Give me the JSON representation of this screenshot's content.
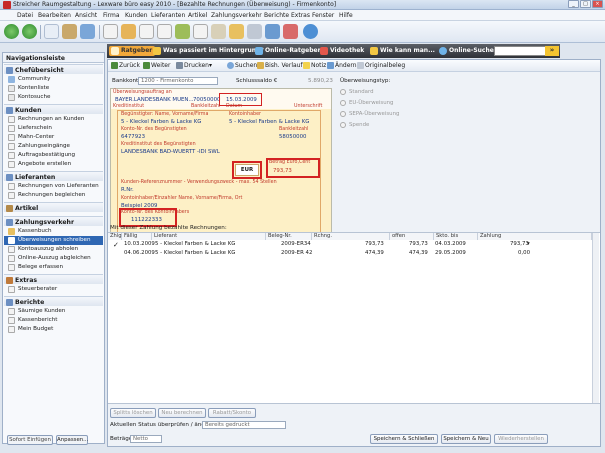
{
  "window": {
    "title": "Streicher Raumgestaltung - Lexware büro easy 2010 - [Bezahlte Rechnungen (Überweisung) - Firmenkonto]"
  },
  "menu": [
    "Datei",
    "Bearbeiten",
    "Ansicht",
    "Firma",
    "Kunden",
    "Lieferanten",
    "Artikel",
    "Zahlungsverkehr",
    "Berichte",
    "Extras",
    "Fenster",
    "Hilfe"
  ],
  "ratgeber": {
    "tabs": [
      "Ratgeber",
      "Was passiert im Hintergrund?",
      "Online-Ratgeber",
      "Videothek",
      "Wie kann man...",
      "Online-Suche"
    ],
    "search_value": "",
    "go": "»"
  },
  "nav": {
    "title": "Navigationsleiste",
    "sections": [
      {
        "label": "Chefübersicht",
        "items": [
          "Community",
          "Kontenliste",
          "Kontosuche"
        ]
      },
      {
        "label": "Kunden",
        "items": [
          "Rechnungen an Kunden",
          "Lieferschein",
          "Mahn-Center",
          "Zahlungseingänge",
          "Auftragsbestätigung",
          "Angebote erstellen"
        ]
      },
      {
        "label": "Lieferanten",
        "items": [
          "Rechnungen von Lieferanten",
          "Rechnungen begleichen"
        ]
      },
      {
        "label": "Artikel",
        "items": []
      },
      {
        "label": "Zahlungsverkehr",
        "items": [
          "Kassenbuch",
          "Überweisungen schreiben",
          "Kontoauszug abholen",
          "Online-Auszug abgleichen",
          "Belege erfassen"
        ]
      },
      {
        "label": "Extras",
        "items": [
          "Steuerberater"
        ]
      },
      {
        "label": "Berichte",
        "items": [
          "Säumige Kunden",
          "Kassenbericht",
          "Mein Budget"
        ]
      }
    ],
    "selected": "Überweisungen schreiben",
    "buttons": [
      "Sofort Einfügen",
      "Anpassen..."
    ]
  },
  "subtoolbar": [
    "Zurück",
    "Weiter",
    "Drucken",
    "Suchen",
    "Bish. Verlauf",
    "Notiz",
    "Ändern",
    "Originalbeleg"
  ],
  "form": {
    "bankkonto_label": "Bankkonto",
    "bankkonto_value": "1200 - Firmenkonto",
    "schlusssaldo_label": "Schlusssaldo €",
    "schlusssaldo_value": "5.890,23",
    "ueberweisungstyp_label": "Überweisungstyp:",
    "types": [
      "Standard",
      "EU-Überweisung",
      "SEPA-Überweisung",
      "Spende"
    ],
    "auftrag": "Überweisungsauftrag an",
    "bank_name": "BAYER.LANDESBANK MUEN...",
    "blz": "70050000",
    "date": "15.03.2009",
    "kreditinstitut_lbl": "Kreditinstitut",
    "bankleitzahl_lbl": "Bankleitzahl",
    "datum_lbl": "Datum",
    "unterschrift_lbl": "Unterschrift",
    "beguenstigter_lbl": "Begünstigter: Name, Vorname/Firma",
    "beguenstigter": "5 - Kleckel Farben & Lacke KG",
    "kontoinhaber_lbl": "Kontoinhaber",
    "kontoinhaber": "5 - Kleckel Farben & Lacke KG",
    "kontonr_lbl": "Konto-Nr. des Begünstigten",
    "kontonr": "6477923",
    "blz2_lbl": "Bankleitzahl",
    "blz2": "58050000",
    "kreditinstitut2_lbl": "Kreditinstitut des Begünstigten",
    "kreditinstitut2": "LANDESBANK BAD-WUERTT -IDI SWL",
    "currency": "EUR",
    "betrag_lbl": "Betrag Euro,Cent",
    "betrag": "793,73",
    "referenz_lbl": "Kunden-Referenznummer - Verwendungszweck - max. 54 Stellen",
    "referenz": "R.Nr.",
    "auftraggeber_lbl": "Kontoinhaber/Einzahler Name, Vorname/Firma, Ort",
    "auftraggeber": "Beispiel 2009",
    "kontonr_inh_lbl": "Konto-Nr. des Kontoinhabers",
    "kontonr_inh": "111222333"
  },
  "table": {
    "caption": "Mit dieser Zahlung bezahlte Rechnungen:",
    "columns": [
      "Zhlg.",
      "Fällig",
      "Lieferant",
      "Beleg-Nr.",
      "Rchng.",
      "offen",
      "Skto. bis",
      "Zahlung"
    ],
    "rows": [
      {
        "mark": "✓",
        "faellig": "10.03.2009",
        "lieferant": "5 - Kleckel Farben & Lacke KG",
        "beleg": "2009-ER34",
        "rchng": "793,73",
        "offen": "793,73",
        "skto": "04.03.2009",
        "zahlung": "793,73"
      },
      {
        "mark": "",
        "faellig": "04.06.2009",
        "lieferant": "5 - Kleckel Farben & Lacke KG",
        "beleg": "2009-ER 42",
        "rchng": "474,39",
        "offen": "474,39",
        "skto": "29.05.2009",
        "zahlung": "0,00"
      }
    ]
  },
  "bottom": {
    "buttons_row1": [
      "Splitts löschen",
      "Neu berechnen",
      "Rabatt/Skonto"
    ],
    "status_label": "Aktuellen Status überprüfen / ändern",
    "status_value": "Bereits gedruckt",
    "betraege_label": "Beträge",
    "betraege_value": "Netto",
    "actions": [
      "Speichern & Schließen",
      "Speichern & Neu",
      "Wiederherstellen"
    ]
  }
}
